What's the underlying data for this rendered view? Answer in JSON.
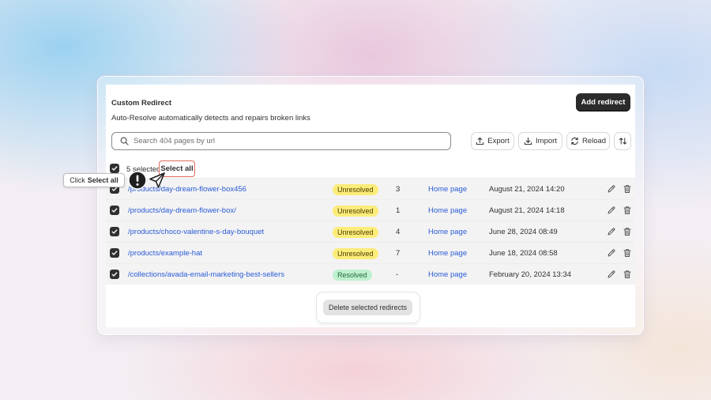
{
  "card": {
    "title": "Custom Redirect",
    "subtitle": "Auto-Resolve automatically detects and repairs broken links",
    "add_button": "Add redirect"
  },
  "search": {
    "placeholder": "Search 404 pages by url",
    "icon": "search-icon"
  },
  "toolbar": {
    "export": "Export",
    "import": "Import",
    "reload": "Reload"
  },
  "selection": {
    "count_label": "5 selected",
    "select_all": "Select all"
  },
  "rows": [
    {
      "url": "/products/day-dream-flower-box456",
      "status": "Unresolved",
      "hits": "3",
      "target": "Home page",
      "date": "August 21, 2024 14:20"
    },
    {
      "url": "/products/day-dream-flower-box/",
      "status": "Unresolved",
      "hits": "1",
      "target": "Home page",
      "date": "August 21, 2024 14:18"
    },
    {
      "url": "/products/choco-valentine-s-day-bouquet",
      "status": "Unresolved",
      "hits": "4",
      "target": "Home page",
      "date": "June 28, 2024 08:49"
    },
    {
      "url": "/products/example-hat",
      "status": "Unresolved",
      "hits": "7",
      "target": "Home page",
      "date": "June 18, 2024 08:58"
    },
    {
      "url": "/collections/avada-email-marketing-best-sellers",
      "status": "Resolved",
      "hits": "-",
      "target": "Home page",
      "date": "February 20, 2024 13:34"
    }
  ],
  "delete_button": "Delete selected redirects",
  "tooltip": {
    "prefix": "Click",
    "target": "Select all"
  },
  "colors": {
    "primary_button": "#2b2b2b",
    "link": "#2a5bd7",
    "unresolved_badge": "#fcec7a",
    "resolved_badge": "#bff0cf",
    "highlight_border": "#e26a5e"
  }
}
